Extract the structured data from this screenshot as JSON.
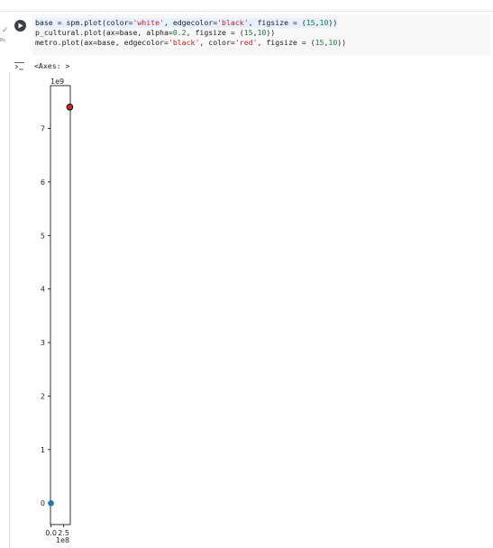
{
  "cell": {
    "code_lines": [
      [
        {
          "t": "base = spm.plot(color=",
          "c": ""
        },
        {
          "t": "'white'",
          "c": "str"
        },
        {
          "t": ", edgecolor=",
          "c": ""
        },
        {
          "t": "'black'",
          "c": "str"
        },
        {
          "t": ", figsize = (",
          "c": ""
        },
        {
          "t": "15",
          "c": "num"
        },
        {
          "t": ",",
          "c": ""
        },
        {
          "t": "10",
          "c": "num"
        },
        {
          "t": "))",
          "c": ""
        }
      ],
      [
        {
          "t": "p_cultural.plot(ax=base, alpha=",
          "c": ""
        },
        {
          "t": "0.2",
          "c": "num"
        },
        {
          "t": ", figsize = (",
          "c": ""
        },
        {
          "t": "15",
          "c": "num"
        },
        {
          "t": ",",
          "c": ""
        },
        {
          "t": "10",
          "c": "num"
        },
        {
          "t": "))",
          "c": ""
        }
      ],
      [
        {
          "t": "metro.plot(ax=base, edgecolor=",
          "c": ""
        },
        {
          "t": "'black'",
          "c": "str"
        },
        {
          "t": ", color=",
          "c": ""
        },
        {
          "t": "'red'",
          "c": "str"
        },
        {
          "t": ", figsize = (",
          "c": ""
        },
        {
          "t": "15",
          "c": "num"
        },
        {
          "t": ",",
          "c": ""
        },
        {
          "t": "10",
          "c": "num"
        },
        {
          "t": "))",
          "c": ""
        }
      ]
    ],
    "exec_count": "0s",
    "output_text": "<Axes: >"
  },
  "icons": {
    "run": "play-icon",
    "status": "check-icon",
    "output": "output-toggle-icon"
  },
  "chart_data": {
    "type": "scatter",
    "y_offset_label": "1e9",
    "x_offset_label": "1e8",
    "y_ticks": [
      0,
      1,
      2,
      3,
      4,
      5,
      6,
      7
    ],
    "y_tick_labels": [
      "0",
      "1",
      "2",
      "3",
      "4",
      "5",
      "6",
      "7"
    ],
    "x_ticks": [
      0.0,
      2.5
    ],
    "x_tick_labels": [
      "0.0",
      "2.5"
    ],
    "xlim": [
      -0.1,
      3.8
    ],
    "ylim": [
      -0.4,
      7.8
    ],
    "series": [
      {
        "color": "#1f77b4",
        "points": [
          [
            0.0,
            0.0
          ]
        ]
      },
      {
        "color": "#d62728",
        "edgecolor": "#000000",
        "points": [
          [
            3.7,
            7.4
          ]
        ]
      }
    ]
  }
}
